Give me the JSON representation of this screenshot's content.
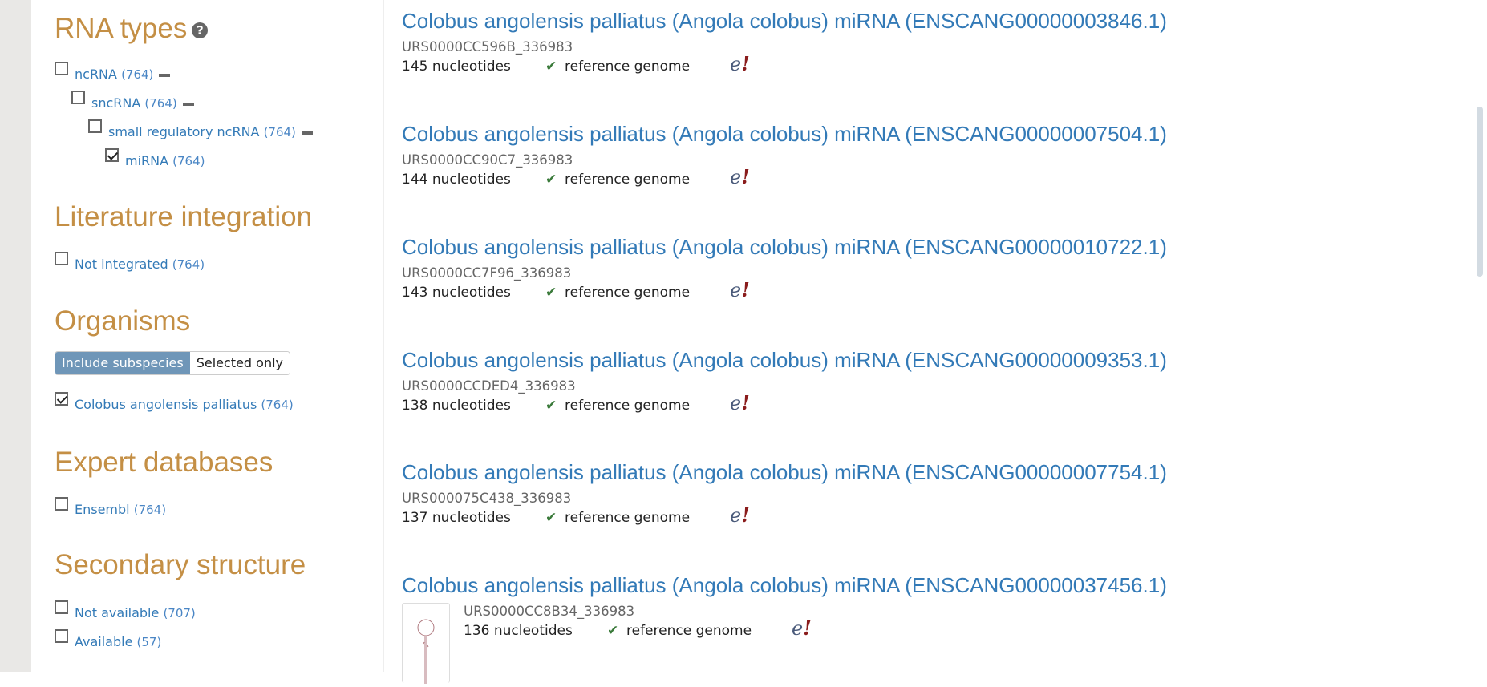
{
  "sidebar": {
    "rna_types": {
      "heading": "RNA types",
      "help_icon": "?",
      "items": [
        {
          "label": "ncRNA",
          "count": "(764)",
          "checked": false
        },
        {
          "label": "sncRNA",
          "count": "(764)",
          "checked": false
        },
        {
          "label": "small regulatory ncRNA",
          "count": "(764)",
          "checked": false
        },
        {
          "label": "miRNA",
          "count": "(764)",
          "checked": true
        }
      ]
    },
    "literature": {
      "heading": "Literature integration",
      "items": [
        {
          "label": "Not integrated",
          "count": "(764)",
          "checked": false
        }
      ]
    },
    "organisms": {
      "heading": "Organisms",
      "toggle": {
        "include_subspecies": "Include subspecies",
        "selected_only": "Selected only",
        "active": "include_subspecies"
      },
      "items": [
        {
          "label": "Colobus angolensis palliatus",
          "count": "(764)",
          "checked": true
        }
      ]
    },
    "expert_databases": {
      "heading": "Expert databases",
      "items": [
        {
          "label": "Ensembl",
          "count": "(764)",
          "checked": false
        }
      ]
    },
    "secondary_structure": {
      "heading": "Secondary structure",
      "items": [
        {
          "label": "Not available",
          "count": "(707)",
          "checked": false
        },
        {
          "label": "Available",
          "count": "(57)",
          "checked": false
        }
      ]
    }
  },
  "results": [
    {
      "title": "Colobus angolensis palliatus (Angola colobus) miRNA (ENSCANG00000003846.1)",
      "urs": "URS0000CC596B_336983",
      "length": "145 nucleotides",
      "tag": "reference genome",
      "db_icon": "e!"
    },
    {
      "title": "Colobus angolensis palliatus (Angola colobus) miRNA (ENSCANG00000007504.1)",
      "urs": "URS0000CC90C7_336983",
      "length": "144 nucleotides",
      "tag": "reference genome",
      "db_icon": "e!"
    },
    {
      "title": "Colobus angolensis palliatus (Angola colobus) miRNA (ENSCANG00000010722.1)",
      "urs": "URS0000CC7F96_336983",
      "length": "143 nucleotides",
      "tag": "reference genome",
      "db_icon": "e!"
    },
    {
      "title": "Colobus angolensis palliatus (Angola colobus) miRNA (ENSCANG00000009353.1)",
      "urs": "URS0000CCDED4_336983",
      "length": "138 nucleotides",
      "tag": "reference genome",
      "db_icon": "e!"
    },
    {
      "title": "Colobus angolensis palliatus (Angola colobus) miRNA (ENSCANG00000007754.1)",
      "urs": "URS000075C438_336983",
      "length": "137 nucleotides",
      "tag": "reference genome",
      "db_icon": "e!"
    },
    {
      "title": "Colobus angolensis palliatus (Angola colobus) miRNA (ENSCANG00000037456.1)",
      "urs": "URS0000CC8B34_336983",
      "length": "136 nucleotides",
      "tag": "reference genome",
      "db_icon": "e!"
    }
  ],
  "colors": {
    "heading": "#c48f45",
    "link": "#337ab7",
    "toggle_active": "#6f96b8",
    "check": "#3a7a3a"
  }
}
